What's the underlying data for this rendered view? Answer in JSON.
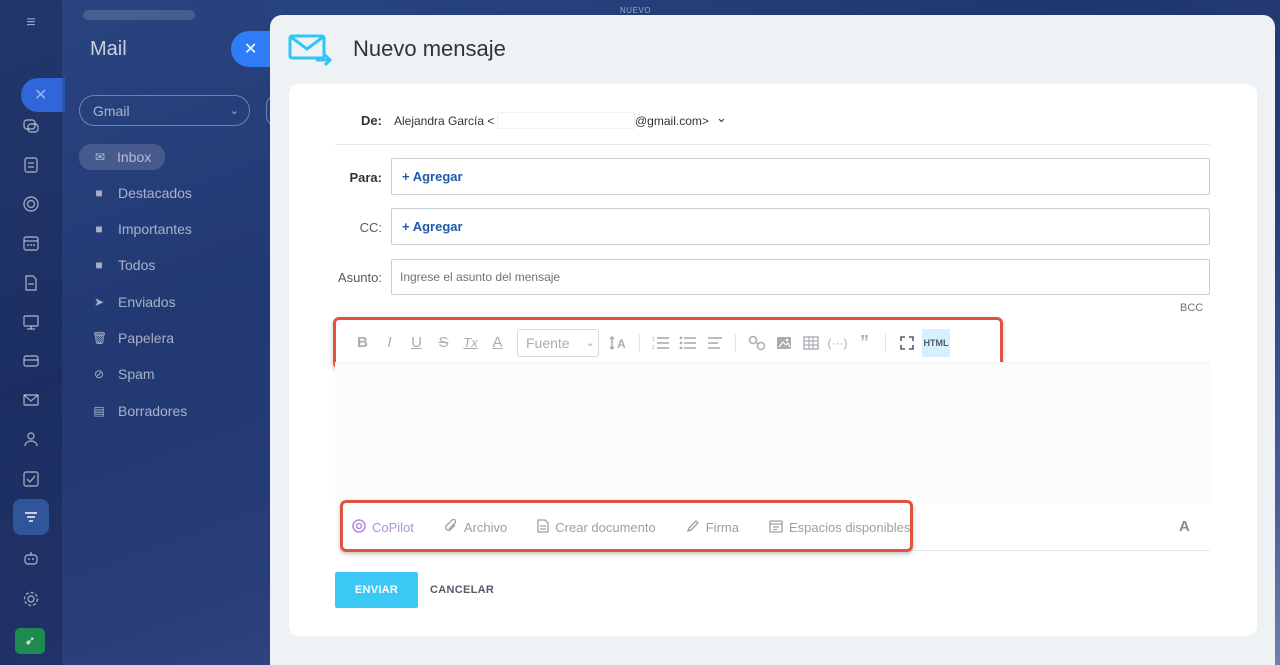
{
  "top_label": "NUEVO",
  "sidebar": {
    "title": "Mail",
    "account": "Gmail",
    "folders": [
      {
        "label": "Inbox",
        "icon": "inbox-icon"
      },
      {
        "label": "Destacados",
        "icon": "folder-icon"
      },
      {
        "label": "Importantes",
        "icon": "folder-icon"
      },
      {
        "label": "Todos",
        "icon": "folder-icon"
      },
      {
        "label": "Enviados",
        "icon": "sent-icon"
      },
      {
        "label": "Papelera",
        "icon": "trash-icon"
      },
      {
        "label": "Spam",
        "icon": "spam-icon"
      },
      {
        "label": "Borradores",
        "icon": "draft-icon"
      }
    ]
  },
  "composer": {
    "title": "Nuevo mensaje",
    "from_label": "De:",
    "from_name": "Alejandra García <",
    "from_domain": "@gmail.com>",
    "to_label": "Para:",
    "to_add": "+ Agregar",
    "cc_label": "CC:",
    "cc_add": "+ Agregar",
    "subject_label": "Asunto:",
    "subject_placeholder": "Ingrese el asunto del mensaje",
    "bcc": "BCC",
    "toolbar": {
      "bold": "B",
      "italic": "I",
      "underline": "U",
      "strike": "S",
      "clear": "Tx",
      "color": "A",
      "font": "Fuente",
      "html": "HTML"
    },
    "bottom_items": [
      {
        "label": "CoPilot",
        "icon": "copilot-icon"
      },
      {
        "label": "Archivo",
        "icon": "paperclip-icon"
      },
      {
        "label": "Crear documento",
        "icon": "document-icon"
      },
      {
        "label": "Firma",
        "icon": "pen-icon"
      },
      {
        "label": "Espacios disponibles",
        "icon": "calendar-slots-icon"
      }
    ],
    "format_toggle": "A",
    "send": "ENVIAR",
    "cancel": "CANCELAR"
  },
  "colors": {
    "accent": "#3bc8f5",
    "link": "#1e5aa8",
    "highlight": "#e0533f",
    "copilot": "#b38ee0"
  }
}
